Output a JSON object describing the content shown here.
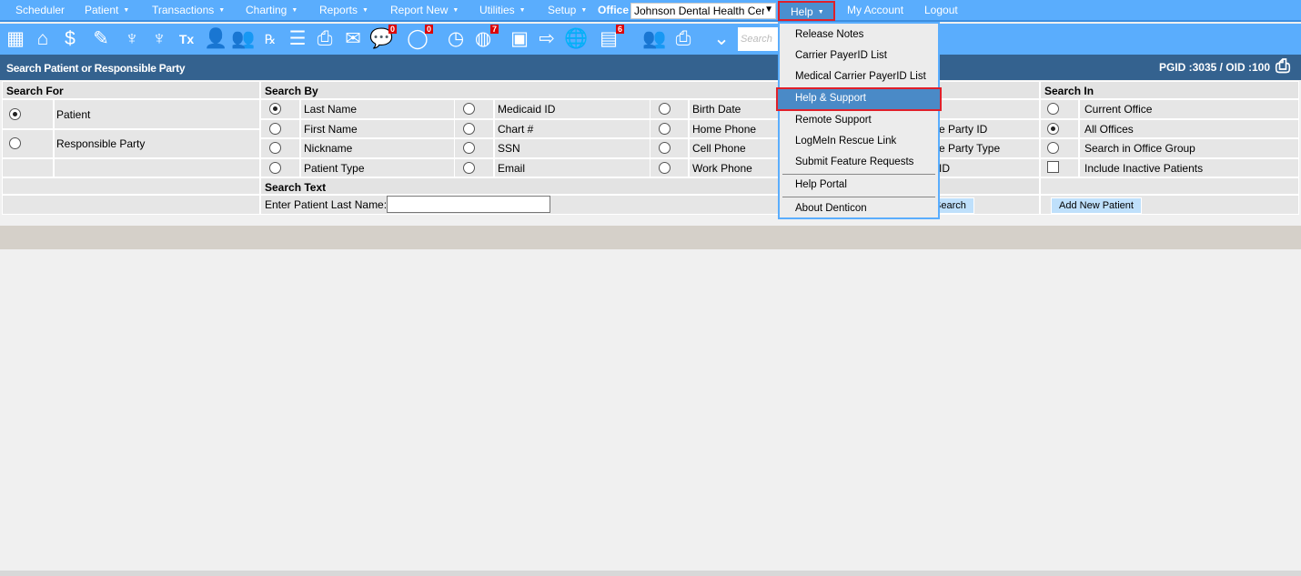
{
  "menubar": {
    "items": [
      {
        "label": "Scheduler",
        "caret": false
      },
      {
        "label": "Patient",
        "caret": true
      },
      {
        "label": "Transactions",
        "caret": true
      },
      {
        "label": "Charting",
        "caret": true
      },
      {
        "label": "Reports",
        "caret": true
      },
      {
        "label": "Report New",
        "caret": true
      },
      {
        "label": "Utilities",
        "caret": true
      },
      {
        "label": "Setup",
        "caret": true
      }
    ],
    "office_label": "Office",
    "office_value": "Johnson Dental Health Cer",
    "help": "Help",
    "my_account": "My Account",
    "logout": "Logout"
  },
  "toolbar": {
    "badges": {
      "messages": "0",
      "chat": "0",
      "patients_online": "7",
      "notes": "6"
    },
    "search_placeholder": "Search"
  },
  "title": {
    "text": "Search Patient or Responsible Party",
    "ids": "PGID :3035  /  OID :100"
  },
  "search_for": {
    "header": "Search For",
    "options": [
      {
        "label": "Patient",
        "checked": true
      },
      {
        "label": "Responsible Party",
        "checked": false
      }
    ]
  },
  "search_by": {
    "header": "Search By",
    "col1": [
      "Last Name",
      "First Name",
      "Nickname",
      "Patient Type"
    ],
    "col2": [
      "Medicaid ID",
      "Chart #",
      "SSN",
      "Email"
    ],
    "col3": [
      "Birth Date",
      "Home Phone",
      "Cell Phone",
      "Work Phone"
    ],
    "col4": [
      "e Party ID",
      "e Party Type",
      "ID"
    ],
    "selected": "Last Name"
  },
  "search_text": {
    "header": "Search Text",
    "label": "Enter Patient Last Name:",
    "value": "",
    "search_button": "Search"
  },
  "search_in": {
    "header": "Search In",
    "options": [
      "Current Office",
      "All Offices",
      "Search in Office Group",
      "Include Inactive Patients"
    ],
    "selected": "All Offices",
    "add_new": "Add New Patient"
  },
  "help_menu": {
    "items": [
      "Release Notes",
      "Carrier PayerID List",
      "Medical Carrier PayerID List",
      "Help & Support",
      "Remote Support",
      "LogMeIn Rescue Link",
      "Submit Feature Requests",
      "Help Portal",
      "About Denticon"
    ],
    "highlighted": "Help & Support"
  }
}
